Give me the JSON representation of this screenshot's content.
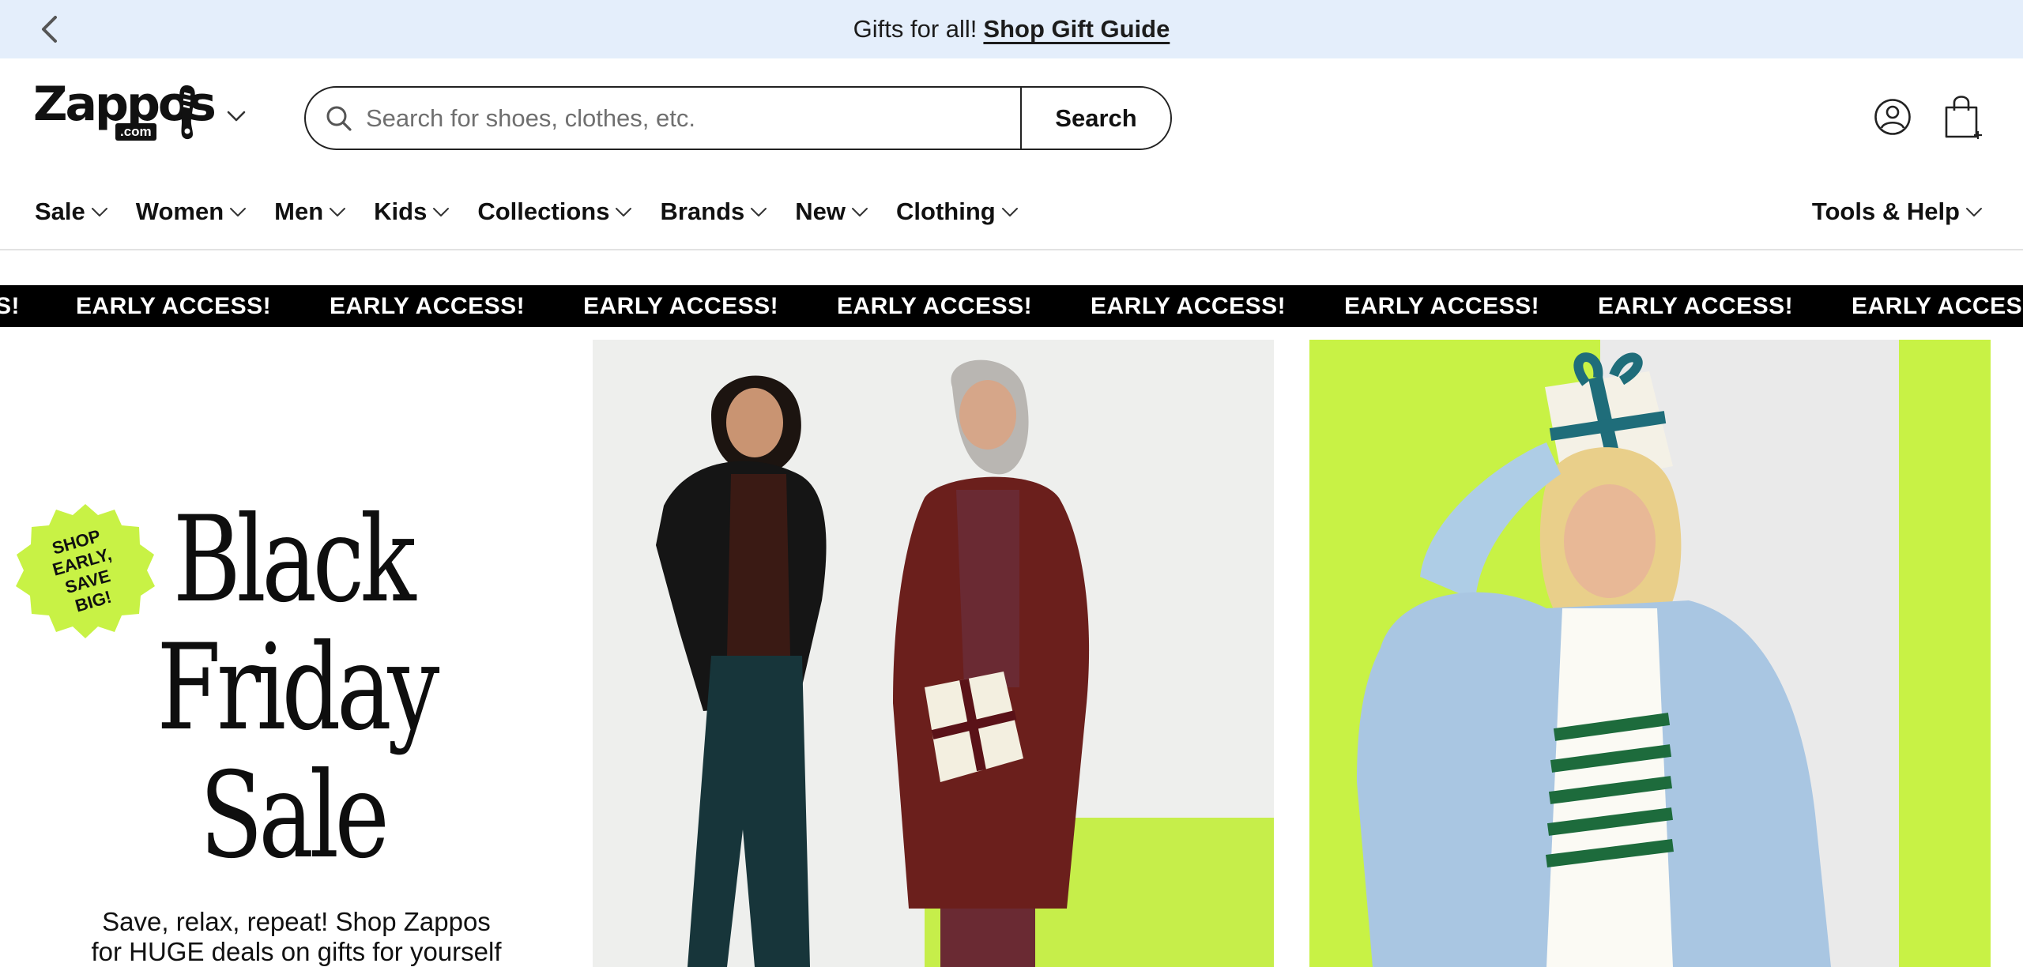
{
  "announcement": {
    "text": "Gifts for all!",
    "link": "Shop Gift Guide"
  },
  "logo": {
    "word": "Zappos",
    "dotcom": ".com"
  },
  "search": {
    "placeholder": "Search for shoes, clothes, etc.",
    "button": "Search"
  },
  "nav": {
    "items": [
      "Sale",
      "Women",
      "Men",
      "Kids",
      "Collections",
      "Brands",
      "New",
      "Clothing"
    ],
    "tools": "Tools & Help"
  },
  "ticker": {
    "text": "EARLY ACCESS!",
    "lead": "S!"
  },
  "hero": {
    "badge": [
      "SHOP",
      "EARLY,",
      "SAVE",
      "BIG!"
    ],
    "title": [
      "Black",
      "Friday",
      "Sale"
    ],
    "subtitle_line1": "Save, relax, repeat! Shop Zappos",
    "subtitle_line2": "for HUGE deals on gifts for yourself"
  },
  "colors": {
    "announce_bg": "#e4eefb",
    "accent_lime": "#c8f245",
    "ticker_bg": "#000000"
  }
}
